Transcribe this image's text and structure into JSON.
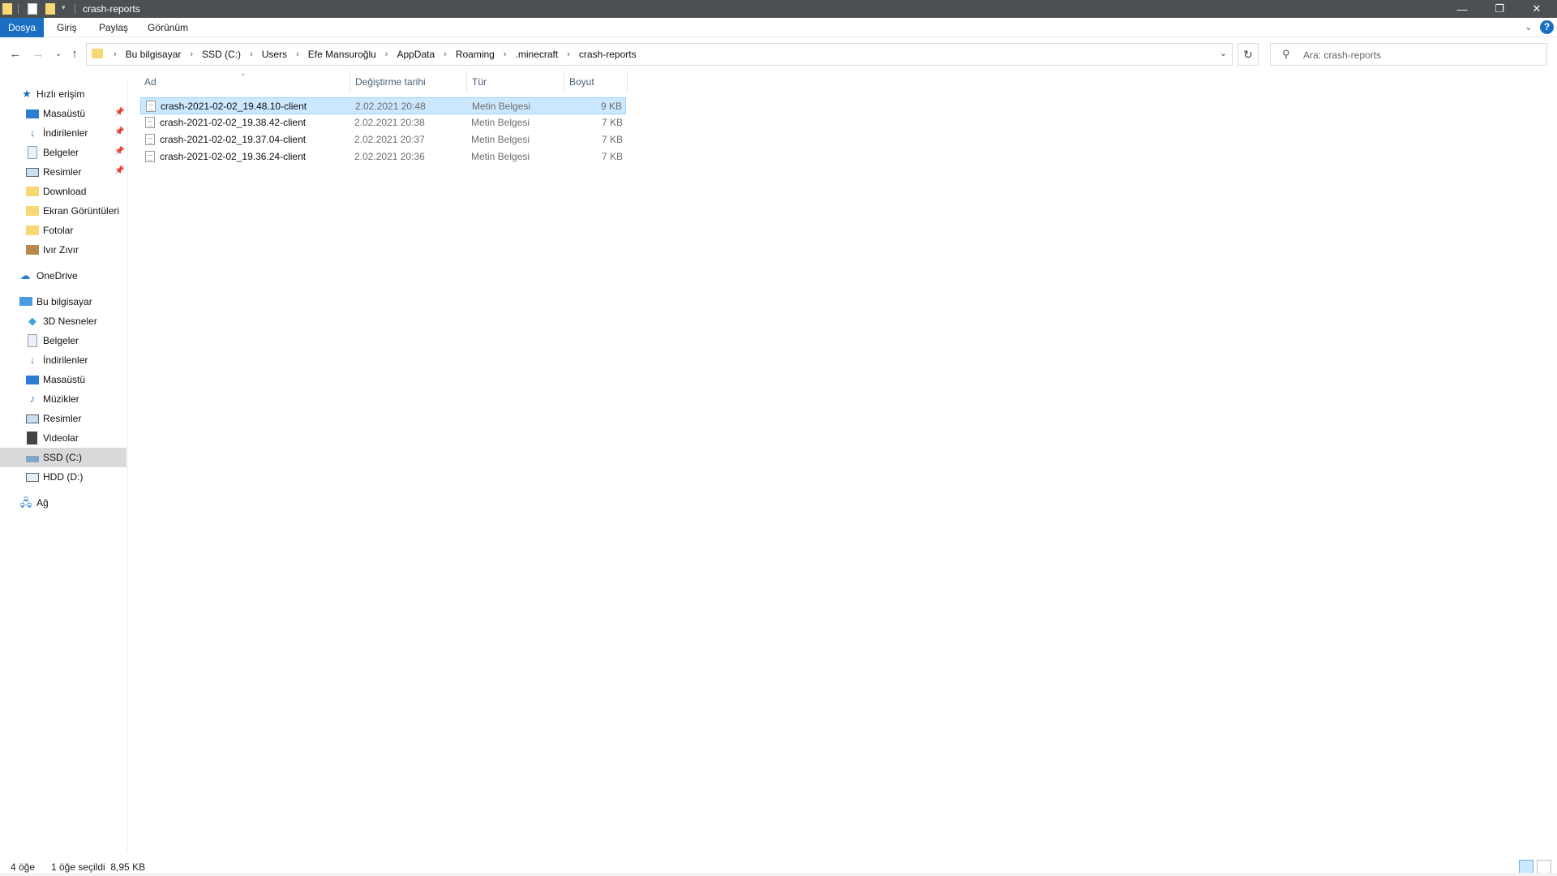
{
  "window": {
    "title": "crash-reports",
    "controls": {
      "minimize": "—",
      "restore": "❐",
      "close": "✕"
    }
  },
  "ribbon": {
    "tabs": [
      "Dosya",
      "Giriş",
      "Paylaş",
      "Görünüm"
    ],
    "active_tab": "Dosya",
    "help": "?"
  },
  "address": {
    "breadcrumbs": [
      "Bu bilgisayar",
      "SSD (C:)",
      "Users",
      "Efe Mansuroğlu",
      "AppData",
      "Roaming",
      ".minecraft",
      "crash-reports"
    ]
  },
  "search": {
    "placeholder": "Ara: crash-reports"
  },
  "sidebar": {
    "quick_access": {
      "label": "Hızlı erişim",
      "items": [
        {
          "label": "Masaüstü",
          "icon": "desktop-icon",
          "pinned": true
        },
        {
          "label": "İndirilenler",
          "icon": "download-icon",
          "pinned": true
        },
        {
          "label": "Belgeler",
          "icon": "documents-icon",
          "pinned": true
        },
        {
          "label": "Resimler",
          "icon": "pictures-icon",
          "pinned": true
        },
        {
          "label": "Download",
          "icon": "folder-icon",
          "pinned": false
        },
        {
          "label": "Ekran Görüntüleri",
          "icon": "folder-icon",
          "pinned": false
        },
        {
          "label": "Fotolar",
          "icon": "folder-icon",
          "pinned": false
        },
        {
          "label": "Ivır Zıvır",
          "icon": "box-folder-icon",
          "pinned": false
        }
      ]
    },
    "onedrive": {
      "label": "OneDrive"
    },
    "this_pc": {
      "label": "Bu bilgisayar",
      "items": [
        {
          "label": "3D Nesneler",
          "icon": "cube-icon"
        },
        {
          "label": "Belgeler",
          "icon": "documents-icon"
        },
        {
          "label": "İndirilenler",
          "icon": "download-icon"
        },
        {
          "label": "Masaüstü",
          "icon": "desktop-icon"
        },
        {
          "label": "Müzikler",
          "icon": "music-icon"
        },
        {
          "label": "Resimler",
          "icon": "pictures-icon"
        },
        {
          "label": "Videolar",
          "icon": "video-icon"
        },
        {
          "label": "SSD (C:)",
          "icon": "drive-icon",
          "selected": true
        },
        {
          "label": "HDD (D:)",
          "icon": "drive-icon"
        }
      ]
    },
    "network": {
      "label": "Ağ"
    }
  },
  "columns": {
    "name": "Ad",
    "date": "Değiştirme tarihi",
    "type": "Tür",
    "size": "Boyut"
  },
  "files": [
    {
      "name": "crash-2021-02-02_19.48.10-client",
      "date": "2.02.2021 20:48",
      "type": "Metin Belgesi",
      "size": "9 KB",
      "selected": true
    },
    {
      "name": "crash-2021-02-02_19.38.42-client",
      "date": "2.02.2021 20:38",
      "type": "Metin Belgesi",
      "size": "7 KB",
      "selected": false
    },
    {
      "name": "crash-2021-02-02_19.37.04-client",
      "date": "2.02.2021 20:37",
      "type": "Metin Belgesi",
      "size": "7 KB",
      "selected": false
    },
    {
      "name": "crash-2021-02-02_19.36.24-client",
      "date": "2.02.2021 20:36",
      "type": "Metin Belgesi",
      "size": "7 KB",
      "selected": false
    }
  ],
  "status": {
    "item_count": "4 öğe",
    "selection": "1 öğe seçildi  8,95 KB"
  },
  "colors": {
    "titlebar": "#4b5055",
    "accent": "#1a6fc2",
    "selection": "#cce8ff"
  }
}
